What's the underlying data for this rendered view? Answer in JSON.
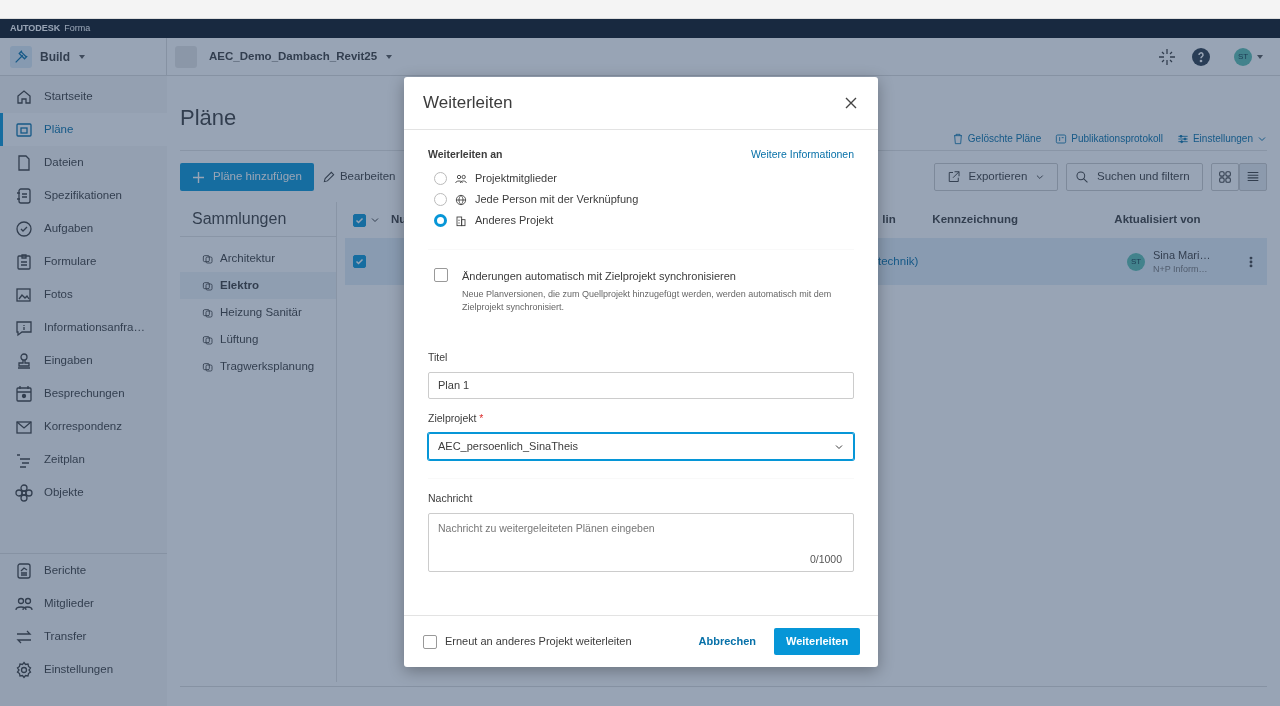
{
  "brand": {
    "name": "**AUTODESK** Forma"
  },
  "header": {
    "module": "Build",
    "project": "AEC_Demo_Dambach_Revit25",
    "avatar": "ST"
  },
  "sidebar": {
    "items": [
      {
        "label": "Startseite",
        "selected": false
      },
      {
        "label": "Pläne",
        "selected": true
      },
      {
        "label": "Dateien",
        "selected": false
      },
      {
        "label": "Spezifikationen",
        "selected": false
      },
      {
        "label": "Aufgaben",
        "selected": false
      },
      {
        "label": "Formulare",
        "selected": false
      },
      {
        "label": "Fotos",
        "selected": false
      },
      {
        "label": "Informationsanfra…",
        "selected": false
      },
      {
        "label": "Eingaben",
        "selected": false
      },
      {
        "label": "Besprechungen",
        "selected": false
      },
      {
        "label": "Korrespondenz",
        "selected": false
      },
      {
        "label": "Zeitplan",
        "selected": false
      },
      {
        "label": "Objekte",
        "selected": false
      }
    ],
    "bottom_items": [
      {
        "label": "Berichte",
        "selected": false
      },
      {
        "label": "Mitglieder",
        "selected": false
      },
      {
        "label": "Transfer",
        "selected": false
      },
      {
        "label": "Einstellungen",
        "selected": false
      }
    ]
  },
  "page": {
    "title": "Pläne",
    "links": [
      "Gelöschte Pläne",
      "Publikationsprotokoll",
      "Einstellungen"
    ],
    "add_button": "Pläne hinzufügen",
    "edit_button": "Bearbeiten",
    "export_button": "Exportieren",
    "search_button": "Suchen und filtern",
    "view_modes": [
      {
        "kind": "grid",
        "selected": false
      },
      {
        "kind": "list",
        "selected": true
      }
    ]
  },
  "collections": {
    "title": "Sammlungen",
    "items": [
      {
        "label": "Architektur",
        "selected": false
      },
      {
        "label": "Elektro",
        "selected": true
      },
      {
        "label": "Heizung Sanitär",
        "selected": false
      },
      {
        "label": "Lüftung",
        "selected": false
      },
      {
        "label": "Tragwerksplanung",
        "selected": false
      }
    ]
  },
  "table": {
    "all_checked": true,
    "columns": [
      "Nu",
      "lin",
      "Kennzeichnung",
      "Aktualisiert von"
    ],
    "rows": [
      {
        "selected": true,
        "column_2": "technik)",
        "updated_by": {
          "avatar": "ST",
          "name": "Sina Mari…",
          "org": "N+P Inform…"
        }
      }
    ]
  },
  "dialog": {
    "title": "Weiterleiten",
    "section_label": "Weiterleiten an",
    "info_link": "Weitere Informationen",
    "options": [
      {
        "label": "Projektmitglieder",
        "selected": false
      },
      {
        "label": "Jede Person mit der Verknüpfung",
        "selected": false
      },
      {
        "label": "Anderes Projekt",
        "selected": true
      }
    ],
    "sync": {
      "label": "Änderungen automatisch mit Zielprojekt synchronisieren",
      "description": "Neue Planversionen, die zum Quellprojekt hinzugefügt werden, werden automatisch mit dem Zielprojekt synchronisiert.",
      "checked": false
    },
    "title_label": "Titel",
    "title_value": "Plan 1",
    "target_label": "Zielprojekt",
    "required_mark": "*",
    "target_value": "AEC_persoenlich_SinaTheis",
    "target_focused": true,
    "message_label": "Nachricht",
    "message_placeholder": "Nachricht zu weitergeleiteten Plänen eingeben",
    "counter": "0/1000",
    "repeat": {
      "label": "Erneut an anderes Projekt weiterleiten",
      "checked": false
    },
    "cancel": "Abbrechen",
    "submit": "Weiterleiten"
  }
}
